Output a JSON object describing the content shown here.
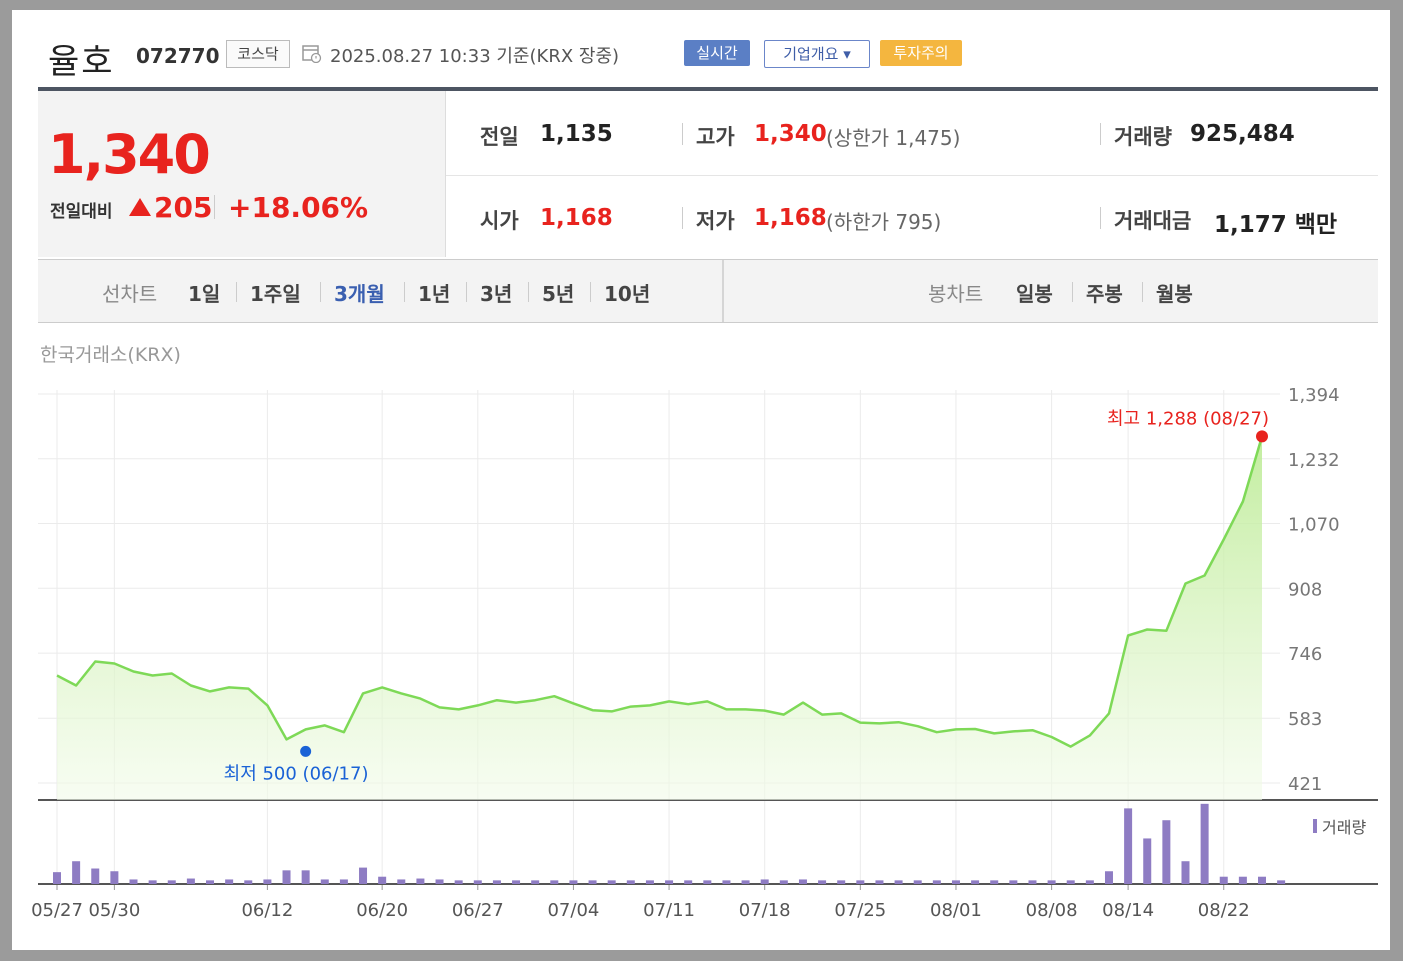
{
  "header": {
    "name": "율호",
    "code": "072770",
    "market": "코스닥",
    "timestamp": "2025.08.27 10:33  기준(KRX 장중)",
    "realtime_btn": "실시간",
    "overview_btn": "기업개요 ▾",
    "warning_badge": "투자주의"
  },
  "price": {
    "current": "1,340",
    "change_label": "전일대비",
    "change_abs": "205",
    "change_pct": "+18.06%"
  },
  "stats": {
    "prev_label": "전일",
    "prev": "1,135",
    "high_label": "고가",
    "high": "1,340",
    "upper_limit": "(상한가 1,475)",
    "volume_label": "거래량",
    "volume": "925,484",
    "open_label": "시가",
    "open": "1,168",
    "low_label": "저가",
    "low": "1,168",
    "lower_limit": "(하한가 795)",
    "value_label": "거래대금",
    "value": "1,177 백만"
  },
  "tabs": {
    "line_label": "선차트",
    "line": [
      "1일",
      "1주일",
      "3개월",
      "1년",
      "3년",
      "5년",
      "10년"
    ],
    "active_line": "3개월",
    "candle_label": "봉차트",
    "candle": [
      "일봉",
      "주봉",
      "월봉"
    ]
  },
  "exchange_label": "한국거래소(KRX)",
  "colors": {
    "up": "#e8231e",
    "line": "#7ed957",
    "volume": "#8e7cc3",
    "low_marker": "#1a62d6"
  },
  "chart_data": {
    "type": "area",
    "y_ticks": [
      "1,394",
      "1,232",
      "1,070",
      "908",
      "746",
      "583",
      "421"
    ],
    "ylim": [
      421,
      1394
    ],
    "x_ticks": [
      "05/27",
      "05/30",
      "06/12",
      "06/20",
      "06/27",
      "07/04",
      "07/11",
      "07/18",
      "07/25",
      "08/01",
      "08/08",
      "08/14",
      "08/22"
    ],
    "x_tick_index": [
      0,
      3,
      11,
      17,
      22,
      27,
      32,
      37,
      42,
      47,
      52,
      56,
      61
    ],
    "price": [
      690,
      665,
      725,
      720,
      700,
      690,
      695,
      665,
      650,
      660,
      657,
      615,
      530,
      555,
      565,
      548,
      645,
      660,
      645,
      632,
      610,
      605,
      615,
      628,
      622,
      628,
      638,
      620,
      603,
      600,
      612,
      615,
      625,
      618,
      625,
      605,
      605,
      602,
      592,
      622,
      592,
      595,
      572,
      570,
      573,
      563,
      548,
      555,
      556,
      545,
      550,
      553,
      536,
      512,
      540,
      595,
      790,
      805,
      802,
      920,
      940,
      1030,
      1125,
      1288
    ],
    "volume": [
      13,
      25,
      17,
      14,
      5,
      4,
      4,
      6,
      4,
      5,
      4,
      5,
      15,
      15,
      5,
      5,
      18,
      8,
      5,
      6,
      5,
      4,
      4,
      4,
      4,
      4,
      4,
      4,
      4,
      4,
      4,
      4,
      4,
      4,
      4,
      4,
      4,
      5,
      4,
      5,
      4,
      4,
      4,
      4,
      4,
      4,
      4,
      4,
      4,
      4,
      4,
      4,
      4,
      4,
      4,
      14,
      83,
      50,
      70,
      25,
      88,
      8,
      8,
      8,
      4
    ],
    "high_label": "최고 1,288 (08/27)",
    "low_label": "최저 500 (06/17)",
    "low_value": 500,
    "low_index": 13,
    "volume_legend": "거래량"
  }
}
